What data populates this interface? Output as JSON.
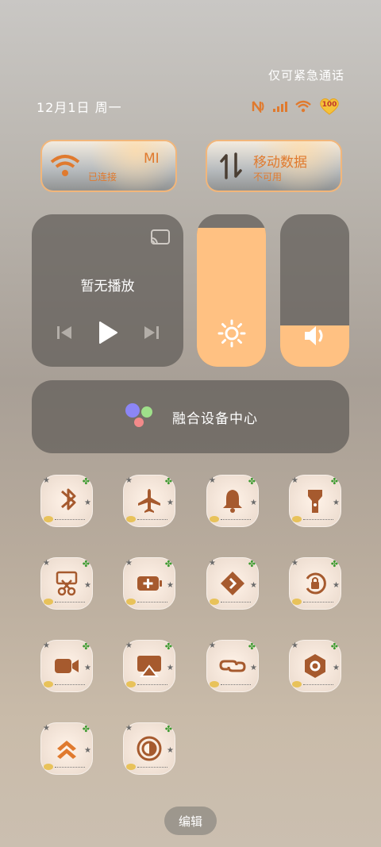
{
  "status": {
    "emergency_only": "仅可紧急通话",
    "date": "12月1日 周一",
    "battery": "100",
    "icons": [
      "nfc-icon",
      "signal-icon",
      "wifi-icon",
      "battery-heart-icon"
    ]
  },
  "wifi_tile": {
    "title": "MI",
    "subtitle": "已连接",
    "icon": "wifi-icon"
  },
  "data_tile": {
    "title": "移动数据",
    "subtitle": "不可用",
    "icon": "mobile-data-icon"
  },
  "media": {
    "now_playing": "暂无播放",
    "icons": [
      "cast-icon",
      "previous-icon",
      "play-icon",
      "next-icon"
    ]
  },
  "sliders": {
    "brightness": {
      "level": 0.91,
      "icon": "sun-icon"
    },
    "volume": {
      "level": 0.27,
      "icon": "speaker-icon"
    }
  },
  "device_center": {
    "label": "融合设备中心"
  },
  "quick_toggles": [
    "bluetooth",
    "airplane-mode",
    "bell",
    "flashlight",
    "screenshot-scissors",
    "battery-saver",
    "code-forward",
    "rotation-lock",
    "video-camera",
    "screen-cast",
    "link",
    "settings-hex",
    "layers-up",
    "dark-mode"
  ],
  "colors": {
    "accent": "#ffc182",
    "icon_brown": "#a65a2e",
    "orange": "#e07a2e"
  },
  "edit_label": "编辑"
}
